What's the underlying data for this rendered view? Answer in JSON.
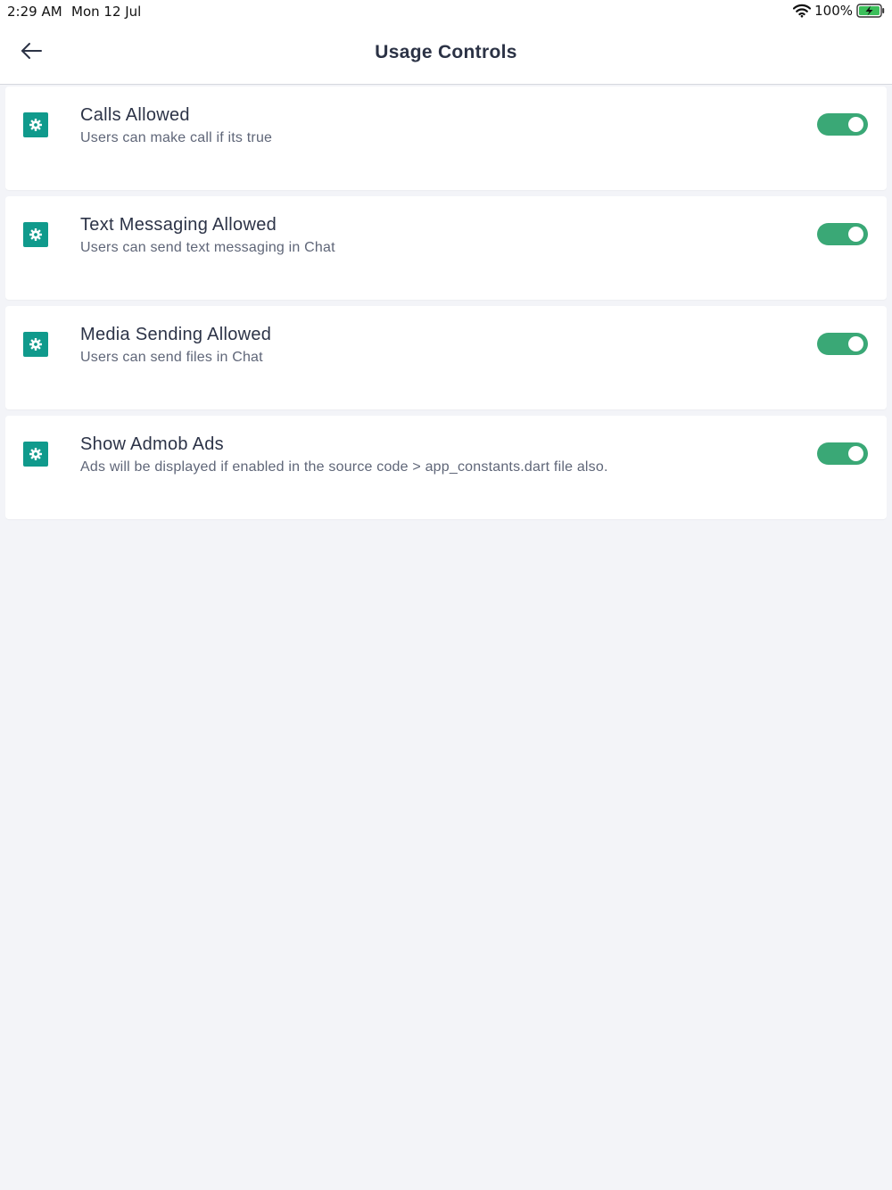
{
  "status_bar": {
    "time": "2:29 AM",
    "date": "Mon 12 Jul",
    "battery": "100%",
    "icons": [
      "wifi-icon",
      "battery-charging-icon"
    ]
  },
  "header": {
    "title": "Usage Controls",
    "back_icon": "arrow-left-icon"
  },
  "settings": [
    {
      "title": "Calls Allowed",
      "description": "Users can make call if its true",
      "icon": "gear-icon",
      "enabled": true
    },
    {
      "title": "Text Messaging Allowed",
      "description": "Users can send text messaging in Chat",
      "icon": "gear-icon",
      "enabled": true
    },
    {
      "title": "Media Sending Allowed",
      "description": "Users can send files in Chat",
      "icon": "gear-icon",
      "enabled": true
    },
    {
      "title": "Show Admob Ads",
      "description": "Ads will be displayed if enabled in the source code > app_constants.dart file also.",
      "icon": "gear-icon",
      "enabled": true
    }
  ],
  "colors": {
    "accent": "#109a8c",
    "toggle_on": "#3aa876",
    "background": "#f3f4f8",
    "title_text": "#2c3347"
  }
}
